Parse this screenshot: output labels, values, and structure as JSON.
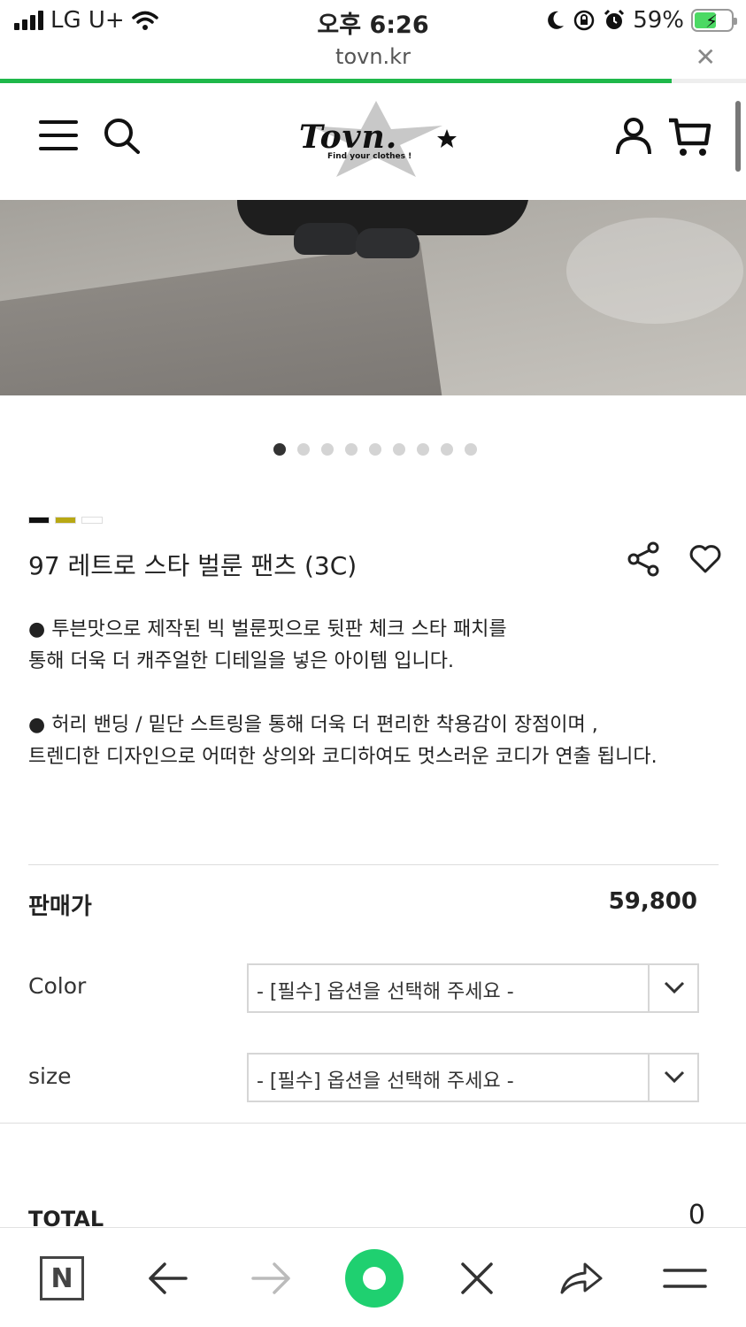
{
  "status_bar": {
    "carrier": "LG U+",
    "time": "오후 6:26",
    "battery": "59%",
    "battery_level": 0.59
  },
  "browser": {
    "url": "tovn.kr",
    "close_glyph": "✕",
    "load_progress": 0.9
  },
  "site": {
    "logo_text": "Tovn.",
    "logo_tagline": "Find your clothes !"
  },
  "gallery": {
    "dot_count": 9,
    "active_index": 0
  },
  "product": {
    "swatch_colors": [
      "#111111",
      "#b8a814",
      "#ffffff"
    ],
    "title": "97 레트로 스타 벌룬 팬츠 (3C)",
    "description": [
      [
        "● 투븐맛으로 제작된 빅 벌룬핏으로 뒷판 체크 스타 패치를",
        "통해 더욱 더 캐주얼한 디테일을 넣은 아이템 입니다."
      ],
      [
        "● 허리 밴딩 / 밑단 스트링을 통해 더욱 더 편리한 착용감이 장점이며 ,",
        "트렌디한 디자인으로 어떠한 상의와 코디하여도 멋스러운 코디가 연출 됩니다."
      ]
    ]
  },
  "purchase": {
    "price_label": "판매가",
    "price_value": "59,800",
    "options": [
      {
        "label": "Color",
        "placeholder": "- [필수] 옵션을 선택해 주세요 -"
      },
      {
        "label": "size",
        "placeholder": "- [필수] 옵션을 선택해 주세요 -"
      }
    ],
    "total_label": "TOTAL",
    "total_value": "0"
  },
  "bottom_nav": {
    "n_label": "N",
    "icons": [
      "naver-home-icon",
      "back-arrow-icon",
      "forward-arrow-icon",
      "green-dot-button",
      "close-icon",
      "share-icon",
      "menu-icon"
    ]
  },
  "colors": {
    "accent_green": "#1fd070",
    "progress_green": "#1fb84a"
  }
}
